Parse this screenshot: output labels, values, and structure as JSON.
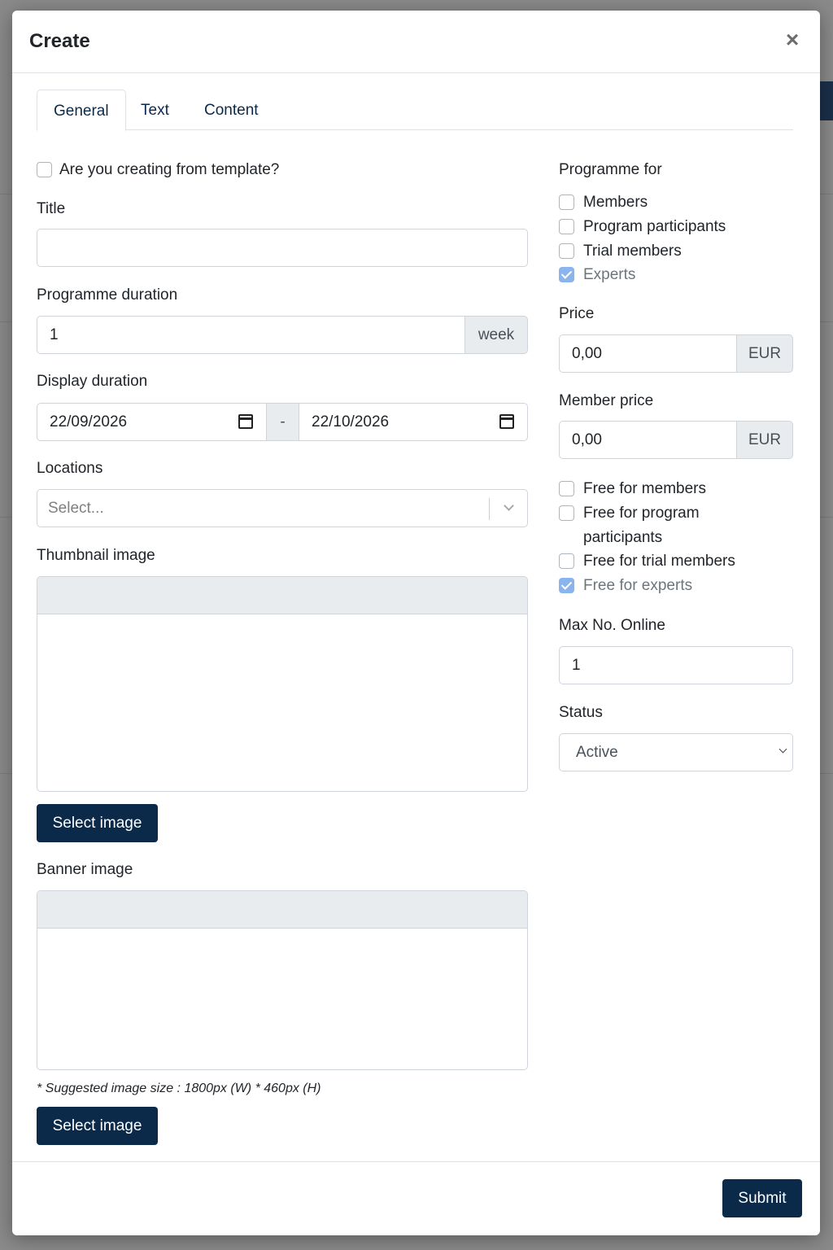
{
  "modal": {
    "title": "Create",
    "close_symbol": "×"
  },
  "tabs": [
    {
      "label": "General",
      "active": true
    },
    {
      "label": "Text",
      "active": false
    },
    {
      "label": "Content",
      "active": false
    }
  ],
  "left": {
    "template_checkbox": {
      "label": "Are you creating from template?",
      "checked": false
    },
    "title": {
      "label": "Title",
      "value": ""
    },
    "programme_duration": {
      "label": "Programme duration",
      "value": "1",
      "unit": "week"
    },
    "display_duration": {
      "label": "Display duration",
      "start": "22/09/2026",
      "separator": "-",
      "end": "22/10/2026"
    },
    "locations": {
      "label": "Locations",
      "placeholder": "Select..."
    },
    "thumbnail": {
      "label": "Thumbnail image",
      "button": "Select image"
    },
    "banner": {
      "label": "Banner image",
      "note": "* Suggested image size : 1800px (W) * 460px (H)",
      "button": "Select image"
    }
  },
  "right": {
    "programme_for": {
      "label": "Programme for",
      "options": [
        {
          "label": "Members",
          "checked": false
        },
        {
          "label": "Program participants",
          "checked": false
        },
        {
          "label": "Trial members",
          "checked": false
        },
        {
          "label": "Experts",
          "checked": true
        }
      ]
    },
    "price": {
      "label": "Price",
      "value": "0,00",
      "currency": "EUR"
    },
    "member_price": {
      "label": "Member price",
      "value": "0,00",
      "currency": "EUR"
    },
    "free_options": [
      {
        "label": "Free for members",
        "checked": false
      },
      {
        "label": "Free for program",
        "label2": "participants",
        "checked": false
      },
      {
        "label": "Free for trial members",
        "checked": false
      },
      {
        "label": "Free for experts",
        "checked": true
      }
    ],
    "max_online": {
      "label": "Max No. Online",
      "value": "1"
    },
    "status": {
      "label": "Status",
      "value": "Active"
    }
  },
  "footer": {
    "submit": "Submit"
  },
  "colors": {
    "primary": "#0b2a4a",
    "checked": "#8ab4ee"
  }
}
